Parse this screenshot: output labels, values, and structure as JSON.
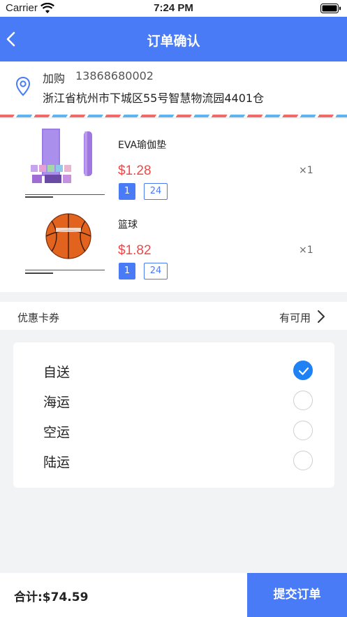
{
  "status_bar": {
    "carrier": "Carrier",
    "time": "7:24 PM",
    "wifi_icon": "wifi-icon",
    "battery_icon": "battery-icon"
  },
  "nav": {
    "title": "订单确认",
    "back_icon": "chevron-left-icon"
  },
  "address": {
    "icon": "location-pin-icon",
    "name": "加购",
    "phone": "13868680002",
    "detail": "浙江省杭州市下城区55号智慧物流园4401仓"
  },
  "products": [
    {
      "name": "EVA瑜伽垫",
      "price": "$1.28",
      "qty": "×1",
      "tag_a": "1",
      "tag_b": "24",
      "image": "yoga-mat-image"
    },
    {
      "name": "篮球",
      "price": "$1.82",
      "qty": "×1",
      "tag_a": "1",
      "tag_b": "24",
      "image": "basketball-image"
    }
  ],
  "coupon": {
    "label": "优惠卡券",
    "status": "有可用",
    "icon": "chevron-right-icon"
  },
  "shipping": {
    "options": [
      {
        "label": "自送",
        "selected": true
      },
      {
        "label": "海运",
        "selected": false
      },
      {
        "label": "空运",
        "selected": false
      },
      {
        "label": "陆运",
        "selected": false
      }
    ]
  },
  "footer": {
    "total": "合计:$74.59",
    "submit_label": "提交订单"
  },
  "colors": {
    "accent": "#4a7bf7",
    "price": "#f04848",
    "radio_checked": "#1e82f5"
  }
}
